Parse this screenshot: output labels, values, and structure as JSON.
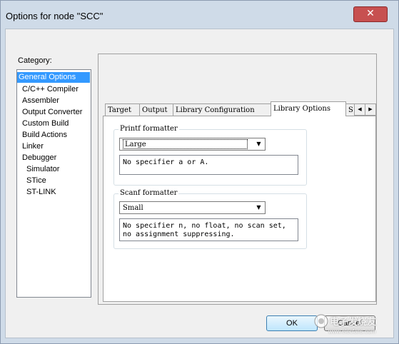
{
  "window": {
    "title": "Options for node \"SCC\"",
    "close_glyph": "✕"
  },
  "category": {
    "label": "Category:",
    "items": [
      {
        "label": "General Options"
      },
      {
        "label": "C/C++ Compiler"
      },
      {
        "label": "Assembler"
      },
      {
        "label": "Output Converter"
      },
      {
        "label": "Custom Build"
      },
      {
        "label": "Build Actions"
      },
      {
        "label": "Linker"
      },
      {
        "label": "Debugger"
      },
      {
        "label": "Simulator"
      },
      {
        "label": "STice"
      },
      {
        "label": "ST-LINK"
      }
    ],
    "selected": "General Options"
  },
  "tabs": [
    {
      "label": "Target"
    },
    {
      "label": "Output"
    },
    {
      "label": "Library Configuration"
    },
    {
      "label": "Library Options"
    },
    {
      "label": "S"
    }
  ],
  "tab_scroll": {
    "left": "◀",
    "right": "▶"
  },
  "printf": {
    "legend": "Printf formatter",
    "value": "Large",
    "description": "No specifier a or A."
  },
  "scanf": {
    "legend": "Scanf formatter",
    "value": "Small",
    "description_line1": "No specifier n, no float, no scan set,",
    "description_line2": "no assignment suppressing."
  },
  "buttons": {
    "ok": "OK",
    "cancel": "Cancel"
  },
  "watermark": {
    "text": "电子发烧友",
    "url": "www.elecfans.com"
  },
  "colors": {
    "selection": "#3399ff",
    "close": "#c75050",
    "frame": "#cfdbe8"
  }
}
